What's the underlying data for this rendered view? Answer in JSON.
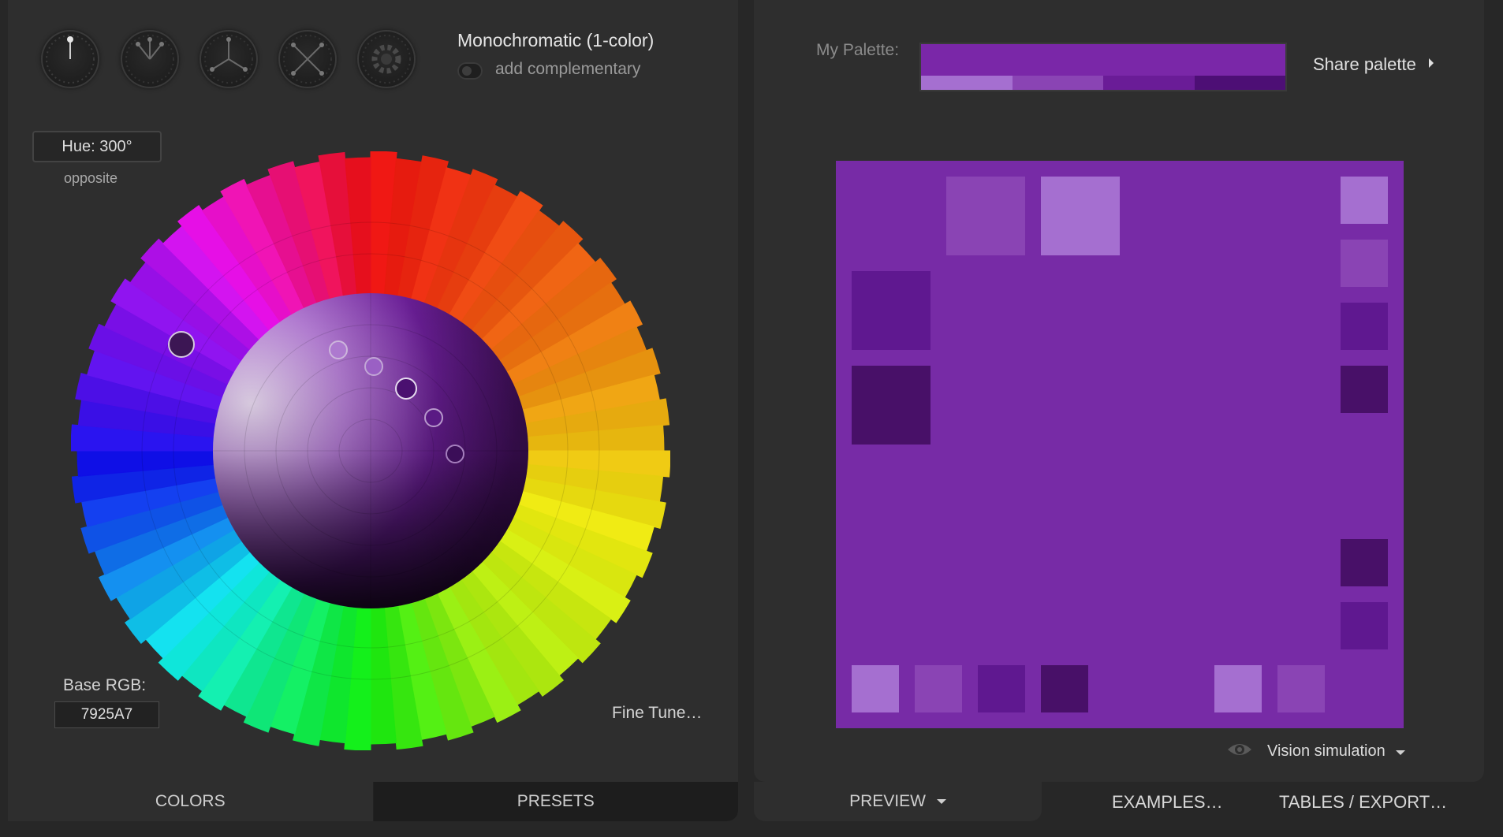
{
  "scheme": {
    "title": "Monochromatic (1-color)",
    "complement_label": "add complementary",
    "icons": [
      "mono-scheme-icon",
      "adjacent-scheme-icon",
      "triad-scheme-icon",
      "tetrad-scheme-icon",
      "freestyle-gear-icon"
    ]
  },
  "hue": {
    "label": "Hue: 300°",
    "opposite": "opposite"
  },
  "base_rgb": {
    "label": "Base RGB:",
    "value": "7925A7"
  },
  "fine_tune": "Fine Tune…",
  "left_tabs": {
    "colors": "COLORS",
    "presets": "PRESETS"
  },
  "palette": {
    "label": "My Palette:",
    "main_color": "#7a27a8",
    "shades": [
      "#a56fd0",
      "#8a44b4",
      "#6a1c97",
      "#4d0f75"
    ],
    "share": "Share palette"
  },
  "preview": {
    "background": "#772ba6",
    "colors": {
      "lightest": "#a56fd0",
      "light": "#8a44b4",
      "dark": "#5f1890",
      "darkest": "#481068"
    }
  },
  "vision": "Vision simulation",
  "right_tabs": {
    "preview": "PREVIEW",
    "examples": "EXAMPLES…",
    "tables": "TABLES / EXPORT…"
  }
}
